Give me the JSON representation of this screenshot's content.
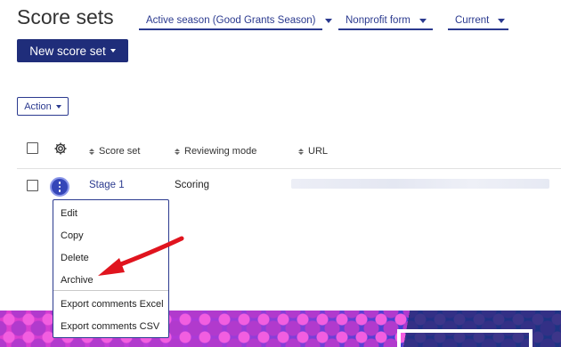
{
  "page": {
    "title": "Score sets"
  },
  "filters": [
    {
      "label": "Active season (Good Grants Season)"
    },
    {
      "label": "Nonprofit form"
    },
    {
      "label": "Current"
    }
  ],
  "toolbar": {
    "new_label": "New score set",
    "action_label": "Action"
  },
  "table": {
    "columns": [
      "Score set",
      "Reviewing mode",
      "URL"
    ],
    "rows": [
      {
        "score_set": "Stage 1",
        "reviewing_mode": "Scoring",
        "url": ""
      }
    ]
  },
  "row_menu": {
    "items": [
      "Edit",
      "Copy",
      "Delete",
      "Archive",
      "Export comments Excel",
      "Export comments CSV"
    ]
  },
  "colors": {
    "accent": "#2b3a8f",
    "primary_button": "#1f2d7a",
    "annotation_arrow": "#e0141e"
  }
}
